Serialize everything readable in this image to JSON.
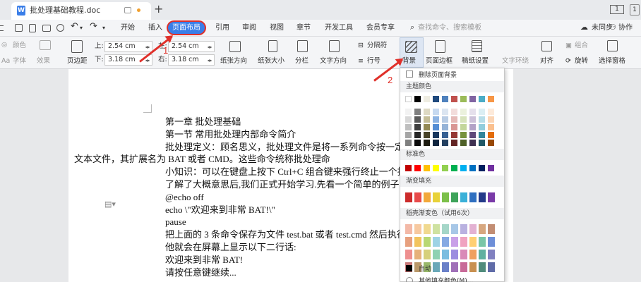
{
  "title_bar": {
    "doc_name": "批处理基础教程.doc",
    "new_tab": "+",
    "page_num": "1",
    "badge": "1"
  },
  "menu": {
    "items": [
      "开始",
      "插入",
      "页面布局",
      "引用",
      "审阅",
      "视图",
      "章节",
      "开发工具",
      "会员专享"
    ],
    "active_index": 2,
    "search": "查找命令、搜索模板",
    "unsynced": "未同步",
    "collab": "协作"
  },
  "toolbar": {
    "color_label": "颜色",
    "effect_label": "效果",
    "font_label": "字体",
    "margin_label": "页边距",
    "top_label": "上:",
    "top_value": "2.54 cm",
    "bottom_label": "下:",
    "bottom_value": "3.18 cm",
    "left_label": "左:",
    "left_value": "2.54 cm",
    "right_label": "右:",
    "right_value": "3.18 cm",
    "orient_label": "纸张方向",
    "size_label": "纸张大小",
    "columns_label": "分栏",
    "textdir_label": "文字方向",
    "break_label": "分隔符",
    "lineno_label": "行号",
    "bg_label": "背景",
    "border_label": "页面边框",
    "grid_label": "稿纸设置",
    "wrap_label": "文字环绕",
    "align_label": "对齐",
    "rotate_label": "旋转",
    "group_label": "组合",
    "select_label": "选择窗格"
  },
  "document": {
    "lines": [
      "第一章  批处理基础",
      "第一节  常用批处理内部命令简介",
      "批处理定义：顾名思义，批处理文件是将一系列命令按一定的",
      "文本文件，其扩展名为 BAT 或者 CMD。这些命令统称批处理命",
      "小知识：可以在键盘上按下 Ctrl+C 组合键来强行终止一个批",
      "了解了大概意思后,我们正式开始学习.先看一个简单的例子!",
      "@echo off",
      "echo \\\"欢迎来到非常 BAT!\\\"",
      "pause",
      "把上面的 3 条命令保存为文件 test.bat 或者 test.cmd 然后执行",
      "他就会在屏幕上显示以下二行话:",
      "欢迎来到非常 BAT!",
      "请按任意键继续..."
    ]
  },
  "bg_menu": {
    "remove": "删除页面背景",
    "theme_title": "主题颜色",
    "standard_title": "标准色",
    "gradient_title": "渐变填充",
    "premium_title": "稻壳渐变色（试用6次）",
    "auto": "自动",
    "more": "其他填充颜色(M)...",
    "theme_top": [
      "#ffffff",
      "#000000",
      "#eeece1",
      "#1f497d",
      "#4f81bd",
      "#c0504d",
      "#9bbb59",
      "#8064a2",
      "#4bacc6",
      "#f79646"
    ],
    "theme_shades": [
      [
        "#f2f2f2",
        "#7f7f7f",
        "#ddd9c3",
        "#c6d9f0",
        "#dbe5f1",
        "#f2dcdb",
        "#ebf1dd",
        "#e5e0ec",
        "#dbeef3",
        "#fdeada"
      ],
      [
        "#d8d8d8",
        "#595959",
        "#c4bd97",
        "#8db3e2",
        "#b8cce4",
        "#e5b9b7",
        "#d7e3bc",
        "#ccc1d9",
        "#b7dde8",
        "#fbd5b5"
      ],
      [
        "#bfbfbf",
        "#3f3f3f",
        "#938953",
        "#548dd4",
        "#95b3d7",
        "#d99694",
        "#c3d69b",
        "#b2a2c7",
        "#92cddc",
        "#fac08f"
      ],
      [
        "#a5a5a5",
        "#262626",
        "#494429",
        "#17365d",
        "#366092",
        "#953734",
        "#76923c",
        "#5f497a",
        "#31859b",
        "#e36c09"
      ],
      [
        "#7f7f7f",
        "#0c0c0c",
        "#1d1b10",
        "#0f243e",
        "#244061",
        "#632423",
        "#4f6128",
        "#3f3151",
        "#205867",
        "#974806"
      ]
    ],
    "standard": [
      "#c00000",
      "#ff0000",
      "#ffc000",
      "#ffff00",
      "#92d050",
      "#00b050",
      "#00b0f0",
      "#0070c0",
      "#002060",
      "#7030a0"
    ],
    "gradient": [
      "#cc2b2b",
      "#e84a4a",
      "#f2a83a",
      "#e8d23a",
      "#7cc04a",
      "#3ea35a",
      "#3ab0d8",
      "#2f6fc0",
      "#243a8a",
      "#7a3aa8"
    ],
    "premium": [
      [
        "#f3b9a7",
        "#f7c9a0",
        "#f0d98f",
        "#cfe2a1",
        "#a5d6c8",
        "#a7c7e7",
        "#b9b1e0",
        "#e3b1d2",
        "#d7a77f",
        "#c28d73"
      ],
      [
        "#e7a07e",
        "#f2c45e",
        "#b8d873",
        "#9ed3e5",
        "#86a9e3",
        "#c9a0e8",
        "#f0a3c0",
        "#ffcf73",
        "#7ac6a7",
        "#6e8fd8"
      ],
      [
        "#ee8f8f",
        "#e6b17a",
        "#d6d07a",
        "#8ed1b2",
        "#7bbde0",
        "#9c8de0",
        "#d98ab8",
        "#f0a060",
        "#60b0a0",
        "#8080c0"
      ],
      [
        "#c87878",
        "#b9986a",
        "#98b86a",
        "#6aa8b8",
        "#6a80c8",
        "#a070b8",
        "#c86a98",
        "#c89050",
        "#508c7c",
        "#606ca8"
      ]
    ],
    "auto_color": "#000000"
  },
  "annotations": {
    "arrow1_label": "1",
    "arrow2_label": "2",
    "arrow_color": "#e0302a"
  }
}
